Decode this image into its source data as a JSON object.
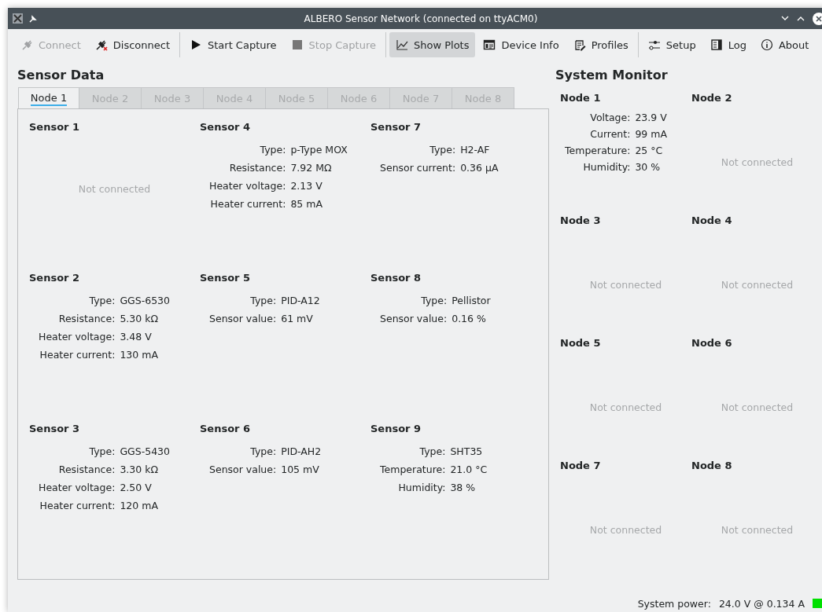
{
  "window": {
    "title": "ALBERO Sensor Network (connected on ttyACM0)"
  },
  "toolbar_groups": [
    [
      {
        "label": "Connect",
        "disabled": true,
        "checked": false
      },
      {
        "label": "Disconnect",
        "disabled": false,
        "checked": false
      }
    ],
    [
      {
        "label": "Start Capture",
        "disabled": false,
        "checked": false
      },
      {
        "label": "Stop Capture",
        "disabled": true,
        "checked": false
      }
    ],
    [
      {
        "label": "Show Plots",
        "disabled": false,
        "checked": true
      },
      {
        "label": "Device Info",
        "disabled": false,
        "checked": false
      },
      {
        "label": "Profiles",
        "disabled": false,
        "checked": false
      }
    ],
    [
      {
        "label": "Setup",
        "disabled": false,
        "checked": false
      },
      {
        "label": "Log",
        "disabled": false,
        "checked": false
      },
      {
        "label": "About",
        "disabled": false,
        "checked": false
      }
    ]
  ],
  "sensor_data": {
    "title": "Sensor Data",
    "tabs": [
      {
        "label": "Node 1",
        "selected": true
      },
      {
        "label": "Node 2",
        "selected": false
      },
      {
        "label": "Node 3",
        "selected": false
      },
      {
        "label": "Node 4",
        "selected": false
      },
      {
        "label": "Node 5",
        "selected": false
      },
      {
        "label": "Node 6",
        "selected": false
      },
      {
        "label": "Node 7",
        "selected": false
      },
      {
        "label": "Node 8",
        "selected": false
      }
    ],
    "sensors": [
      {
        "title": "Sensor 1",
        "status": "Not connected"
      },
      {
        "title": "Sensor 4",
        "fields": [
          {
            "label": "Type:",
            "value": "p-Type MOX"
          },
          {
            "label": "Resistance:",
            "value": "7.92 MΩ"
          },
          {
            "label": "Heater voltage:",
            "value": "2.13 V"
          },
          {
            "label": "Heater current:",
            "value": "85 mA"
          }
        ]
      },
      {
        "title": "Sensor 7",
        "fields": [
          {
            "label": "Type:",
            "value": "H2-AF"
          },
          {
            "label": "Sensor current:",
            "value": "0.36 µA"
          }
        ]
      },
      {
        "title": "Sensor 2",
        "fields": [
          {
            "label": "Type:",
            "value": "GGS-6530"
          },
          {
            "label": "Resistance:",
            "value": "5.30 kΩ"
          },
          {
            "label": "Heater voltage:",
            "value": "3.48 V"
          },
          {
            "label": "Heater current:",
            "value": "130 mA"
          }
        ]
      },
      {
        "title": "Sensor 5",
        "fields": [
          {
            "label": "Type:",
            "value": "PID-A12"
          },
          {
            "label": "Sensor value:",
            "value": "61 mV"
          }
        ]
      },
      {
        "title": "Sensor 8",
        "fields": [
          {
            "label": "Type:",
            "value": "Pellistor"
          },
          {
            "label": "Sensor value:",
            "value": "0.16 %"
          }
        ]
      },
      {
        "title": "Sensor 3",
        "fields": [
          {
            "label": "Type:",
            "value": "GGS-5430"
          },
          {
            "label": "Resistance:",
            "value": "3.30 kΩ"
          },
          {
            "label": "Heater voltage:",
            "value": "2.50 V"
          },
          {
            "label": "Heater current:",
            "value": "120 mA"
          }
        ]
      },
      {
        "title": "Sensor 6",
        "fields": [
          {
            "label": "Type:",
            "value": "PID-AH2"
          },
          {
            "label": "Sensor value:",
            "value": "105 mV"
          }
        ]
      },
      {
        "title": "Sensor 9",
        "fields": [
          {
            "label": "Type:",
            "value": "SHT35"
          },
          {
            "label": "Temperature:",
            "value": "21.0 °C"
          },
          {
            "label": "Humidity:",
            "value": "38 %"
          }
        ]
      }
    ]
  },
  "system_monitor": {
    "title": "System Monitor",
    "nodes": [
      {
        "title": "Node 1",
        "fields": [
          {
            "label": "Voltage:",
            "value": "23.9 V"
          },
          {
            "label": "Current:",
            "value": "99 mA"
          },
          {
            "label": "Temperature:",
            "value": "25 °C"
          },
          {
            "label": "Humidity:",
            "value": "30 %"
          }
        ]
      },
      {
        "title": "Node 2",
        "status": "Not connected"
      },
      {
        "title": "Node 3",
        "status": "Not connected"
      },
      {
        "title": "Node 4",
        "status": "Not connected"
      },
      {
        "title": "Node 5",
        "status": "Not connected"
      },
      {
        "title": "Node 6",
        "status": "Not connected"
      },
      {
        "title": "Node 7",
        "status": "Not connected"
      },
      {
        "title": "Node 8",
        "status": "Not connected"
      }
    ]
  },
  "status_bar": {
    "label": "System power:",
    "value": "24.0 V @ 0.134 A",
    "power_ok": true
  }
}
